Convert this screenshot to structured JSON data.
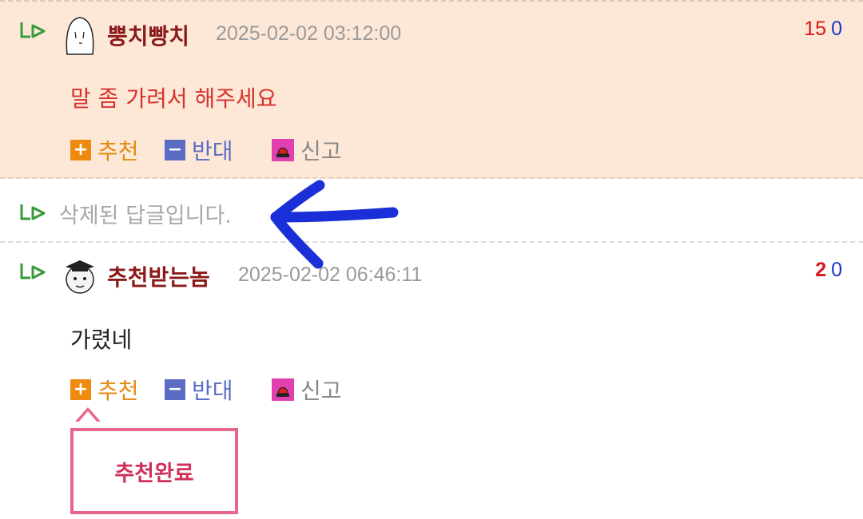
{
  "comments": [
    {
      "nickname": "뿡치빵치",
      "time": "2025-02-02 03:12:00",
      "votes_up": "15",
      "votes_down": "0",
      "text": "말 좀 가려서 해주세요",
      "text_color": "#d6322c",
      "highlight_bg": "#fde8d7"
    },
    {
      "deleted_text": "삭제된 답글입니다."
    },
    {
      "nickname": "추천받는놈",
      "time": "2025-02-02 06:46:11",
      "votes_up": "2",
      "votes_down": "0",
      "text": "가렸네",
      "text_color": "#222222"
    }
  ],
  "actions": {
    "recommend": "추천",
    "oppose": "반대",
    "report": "신고",
    "recommend_icon": "+",
    "oppose_icon": "−"
  },
  "tooltip": {
    "text": "추천완료"
  },
  "colors": {
    "nickname": "#8a1a1a",
    "vote_up": "#d81818",
    "vote_down": "#1a36c8",
    "recommend": "#ee8a10",
    "oppose": "#5a6cc4",
    "tooltip_border": "#e8668a",
    "annotation_arrow": "#1a2fd8"
  }
}
